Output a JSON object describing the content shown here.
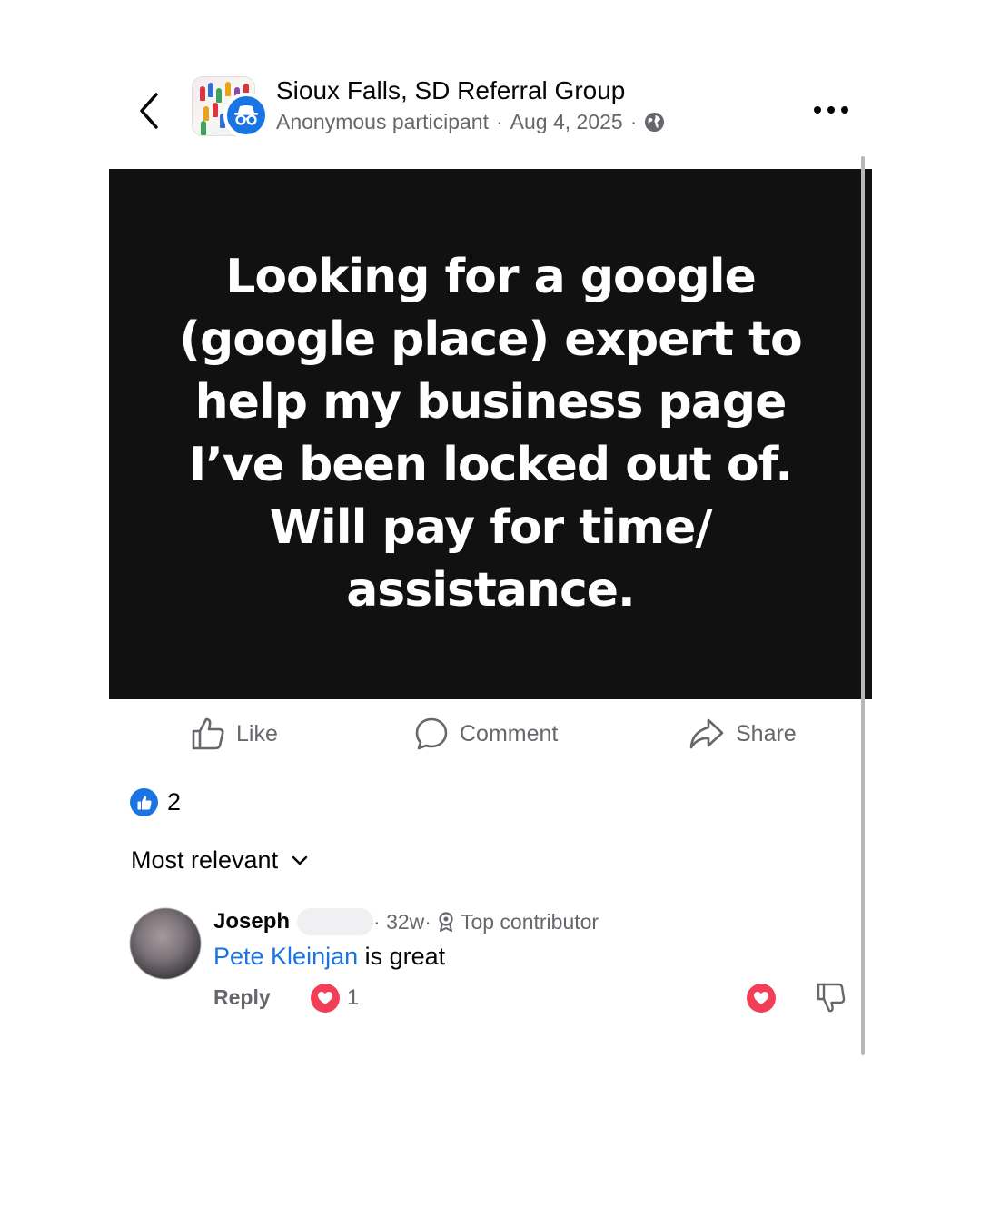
{
  "header": {
    "group_name": "Sioux Falls, SD Referral Group",
    "author": "Anonymous participant",
    "separator": "·",
    "date": "Aug 4, 2025",
    "privacy_icon": "globe-icon"
  },
  "post": {
    "text": "Looking for a google (google place) expert to help my business page I’ve been locked out of. Will pay for time/ assistance.",
    "background_color": "#111111",
    "text_color": "#ffffff"
  },
  "actions": {
    "like_label": "Like",
    "comment_label": "Comment",
    "share_label": "Share"
  },
  "reactions": {
    "icon": "like-icon",
    "count": "2"
  },
  "comments_sort": {
    "label": "Most relevant"
  },
  "comments": [
    {
      "author": "Joseph",
      "age": "· 32w·",
      "badge": "Top contributor",
      "mention": "Pete Kleinjan",
      "text": " is great",
      "reply_label": "Reply",
      "love_count": "1"
    }
  ],
  "colors": {
    "accent": "#1b74e4",
    "love": "#f33e58",
    "secondary_text": "#65676b"
  }
}
